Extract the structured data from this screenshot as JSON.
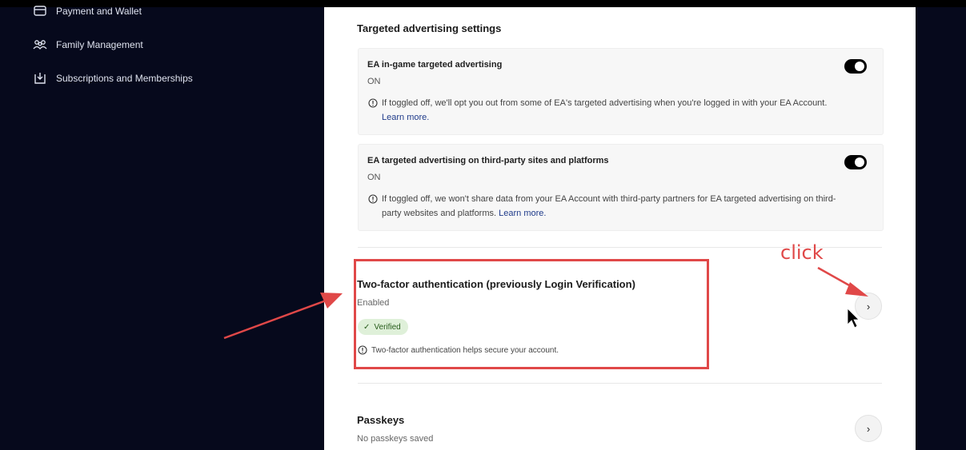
{
  "sidebar": {
    "items": [
      {
        "label": "Payment and Wallet",
        "icon": "wallet-icon"
      },
      {
        "label": "Family Management",
        "icon": "family-icon"
      },
      {
        "label": "Subscriptions and Memberships",
        "icon": "subscription-icon"
      }
    ]
  },
  "advertising": {
    "heading": "Targeted advertising settings",
    "cards": [
      {
        "title": "EA in-game targeted advertising",
        "state": "ON",
        "info": "If toggled off, we'll opt you out from some of EA's targeted advertising when you're logged in with your EA Account.",
        "link": "Learn more."
      },
      {
        "title": "EA targeted advertising on third-party sites and platforms",
        "state": "ON",
        "info": "If toggled off, we won't share data from your EA Account with third-party partners for EA targeted advertising on third-party websites and platforms.",
        "link": "Learn more."
      }
    ]
  },
  "two_factor": {
    "title": "Two-factor authentication (previously Login Verification)",
    "state": "Enabled",
    "badge": "Verified",
    "note": "Two-factor authentication helps secure your account."
  },
  "passkeys": {
    "title": "Passkeys",
    "state": "No passkeys saved"
  },
  "annotation": {
    "click_label": "click",
    "color": "#e04848"
  }
}
